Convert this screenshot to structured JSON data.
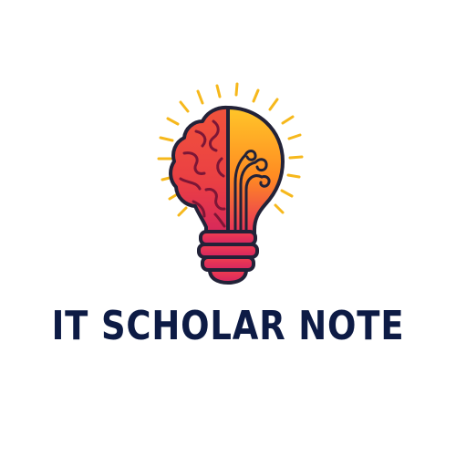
{
  "logo": {
    "name": "IT SCHOLAR NOTE",
    "icon": "brain-lightbulb-icon",
    "colors": {
      "text": "#0d1b45",
      "ray": "#f6b81c",
      "outline": "#222238",
      "brain": "#ea4a3c",
      "bulb_top": "#ffc428",
      "bulb_bottom": "#e8305a",
      "base": "#ea2f58"
    }
  }
}
